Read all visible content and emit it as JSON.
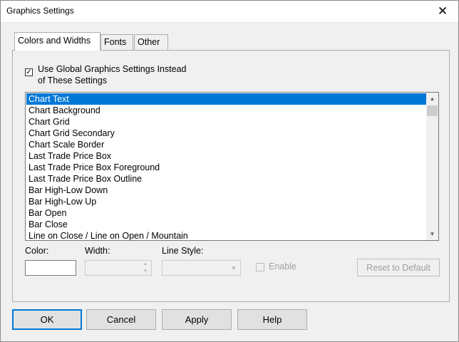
{
  "window": {
    "title": "Graphics Settings",
    "close_glyph": "✕"
  },
  "tabs": [
    {
      "label": "Colors and Widths",
      "active": true
    },
    {
      "label": "Fonts",
      "active": false
    },
    {
      "label": "Other",
      "active": false
    }
  ],
  "global_settings": {
    "checked": true,
    "check_glyph": "✓",
    "label_line1": "Use Global Graphics Settings Instead",
    "label_line2": "of These Settings"
  },
  "element_list": {
    "selected_index": 0,
    "items": [
      "Chart Text",
      "Chart Background",
      "Chart Grid",
      "Chart Grid Secondary",
      "Chart Scale Border",
      "Last Trade Price Box",
      "Last Trade Price Box Foreground",
      "Last Trade Price Box Outline",
      "Bar High-Low Down",
      "Bar High-Low Up",
      "Bar Open",
      "Bar Close",
      "Line on Close / Line on Open / Mountain"
    ],
    "scroll_up_glyph": "▲",
    "scroll_down_glyph": "▼"
  },
  "fields": {
    "color_label": "Color:",
    "color_value": "#ffffff",
    "width_label": "Width:",
    "width_value": "",
    "line_style_label": "Line Style:",
    "line_style_value": "",
    "enable_label": "Enable",
    "enable_checked": false,
    "reset_label": "Reset to Default",
    "spin_up_glyph": "▲",
    "spin_down_glyph": "▼",
    "dropdown_glyph": "▼"
  },
  "buttons": {
    "ok": "OK",
    "cancel": "Cancel",
    "apply": "Apply",
    "help": "Help"
  }
}
